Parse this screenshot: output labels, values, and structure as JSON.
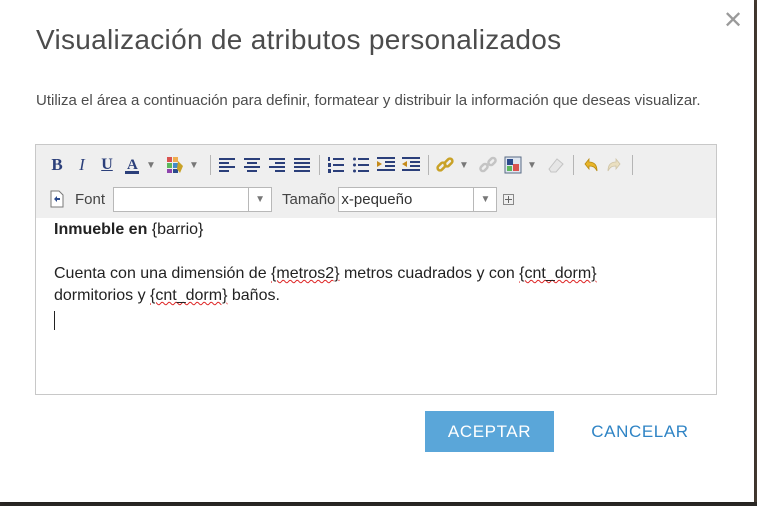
{
  "dialog": {
    "title": "Visualización de atributos personalizados",
    "description": "Utiliza el área a continuación para definir, formatear y distribuir la información que deseas visualizar.",
    "close_glyph": "✕"
  },
  "toolbar": {
    "bold": "B",
    "italic": "I",
    "underline": "U",
    "font_color_glyph": "A",
    "font_label": "Font",
    "font_value": "",
    "size_label": "Tamaño",
    "size_value": "x-pequeño"
  },
  "content": {
    "line1_bold": "Inmueble en",
    "line1_field": " {barrio}",
    "line2_part1": "Cuenta con una dimensión de ",
    "line2_field1": "{metros2}",
    "line2_part2": " metros cuadrados y con ",
    "line2_field2": "{cnt_dorm}",
    "line3_part1": "dormitorios y ",
    "line3_field": "{cnt_dorm}",
    "line3_part2": " baños."
  },
  "buttons": {
    "accept": "ACEPTAR",
    "cancel": "CANCELAR"
  },
  "colors": {
    "accent": "#5aa6d9",
    "link": "#2f84c5",
    "toolbar_bg": "#efefef"
  },
  "icons": [
    "bold-icon",
    "italic-icon",
    "underline-icon",
    "font-color-icon",
    "highlight-color-icon",
    "align-left-icon",
    "align-center-icon",
    "align-right-icon",
    "justify-icon",
    "ordered-list-icon",
    "unordered-list-icon",
    "indent-icon",
    "outdent-icon",
    "insert-link-icon",
    "unlink-icon",
    "insert-image-icon",
    "eraser-icon",
    "undo-icon",
    "redo-icon",
    "edit-source-icon"
  ]
}
